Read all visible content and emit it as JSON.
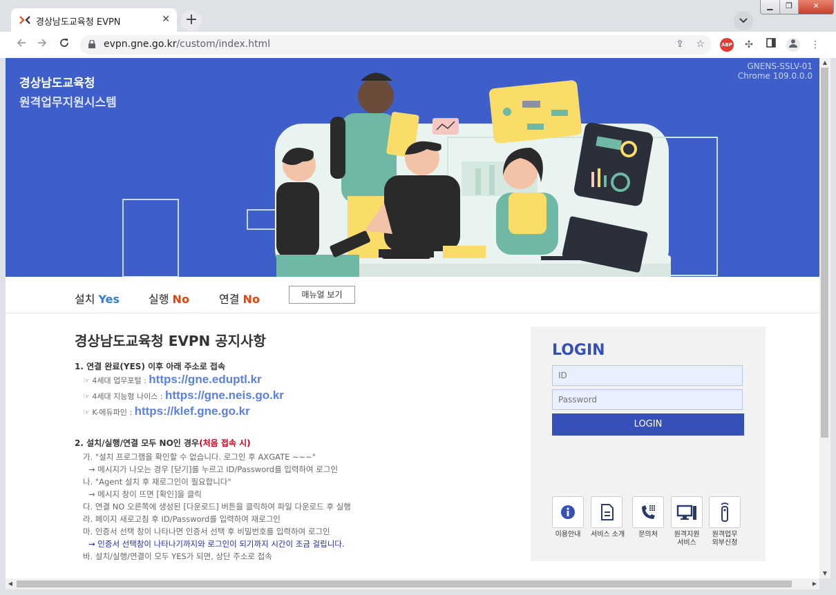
{
  "browser": {
    "tab_title": "경상남도교육청 EVPN",
    "tab_close": "✕",
    "new_tab": "+",
    "url_domain": "evpn.gne.go.kr",
    "url_path": "/custom/index.html",
    "icons": [
      "back-icon",
      "forward-icon",
      "reload-icon",
      "share-icon",
      "star-icon",
      "adblock-icon",
      "extensions-icon",
      "sidepanel-icon",
      "profile-icon",
      "menu-icon"
    ],
    "abp_label": "ABP"
  },
  "banner": {
    "org_name": "경상남도교육청",
    "org_sub": "원격업무지원시스템",
    "ver_1": "GNENS-SSLV-01",
    "ver_2": "Chrome 109.0.0.0"
  },
  "status": {
    "install_label": "설치",
    "install_value": "Yes",
    "run_label": "실행",
    "run_value": "No",
    "connect_label": "연결",
    "connect_value": "No",
    "manual_button": "매뉴얼 보기"
  },
  "notice": {
    "title": "경상남도교육청 EVPN 공지사항",
    "item1": "1. 연결 완료(YES) 이후 아래 주소로 접속",
    "links": [
      {
        "prefix": "☞ 4세대 업무포털 : ",
        "url": "https://gne.eduptl.kr"
      },
      {
        "prefix": "☞ 4세대 지능형 나이스 : ",
        "url": "https://gne.neis.go.kr"
      },
      {
        "prefix": "☞ K-에듀파인 : ",
        "url": "https://klef.gne.go.kr"
      }
    ],
    "item2": "2. 설치/실행/연결 모두 NO인 경우",
    "item2_red": "(처음 접속 시)",
    "lines": [
      "가. \"설치 프로그램을 확인할 수 없습니다. 로그인 후 AXGATE ~~~\"",
      "→ 메시지가 나오는 경우 [닫기]를 누르고 ID/Password를 입력하여 로그인",
      "나. \"Agent 설치 후 재로그인이 필요합니다\"",
      "→ 메시지 창이 뜨면 [확인]을 클릭",
      "다. 연결 NO 오른쪽에 생성된 [다운로드] 버튼을 클릭하여 파일 다운로드 후 실행",
      "라. 페이지 새로고침 후 ID/Password를 입력하여 재로그인",
      "마. 인증서 선택 창이 나타나면 인증서 선택 후 비밀번호를 입력하여 로그인",
      "→ 인증서 선택창이 나타나기까지와 로그인이 되기까지 시간이 조금 걸립니다.",
      "바. 설치/실행/연결이 모두 YES가 되면, 상단 주소로 접속"
    ]
  },
  "login": {
    "title": "LOGIN",
    "id_placeholder": "ID",
    "pw_placeholder": "Password",
    "button": "LOGIN"
  },
  "services": [
    {
      "label": "이용안내",
      "icon": "info-icon"
    },
    {
      "label": "서비스 소개",
      "icon": "document-icon"
    },
    {
      "label": "문의처",
      "icon": "phone-icon"
    },
    {
      "label": "원격지원\n서비스",
      "icon": "computer-icon"
    },
    {
      "label": "원격업무\n외부신청",
      "icon": "remote-control-icon"
    }
  ],
  "colors": {
    "banner_bg": "#3e5fc9",
    "login_accent": "#3550b8",
    "yes": "#2f7de1",
    "no": "#e8410d"
  }
}
